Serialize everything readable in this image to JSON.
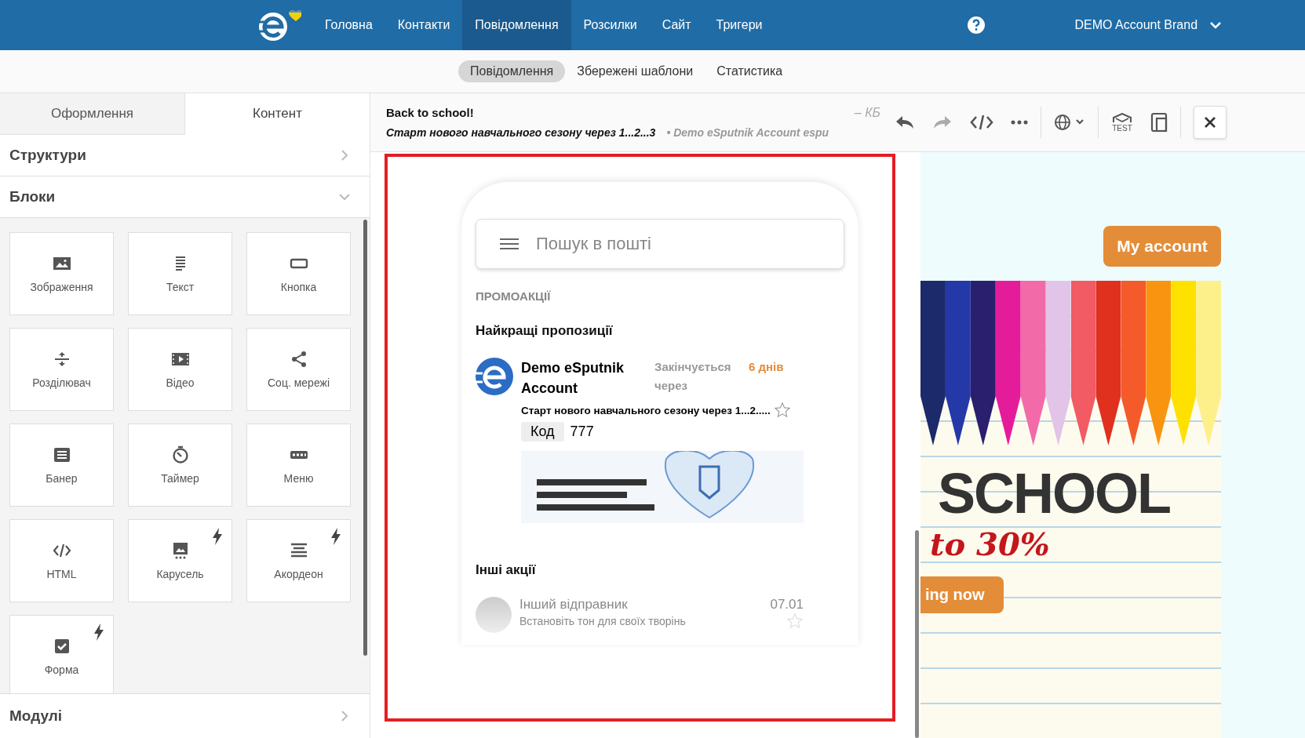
{
  "nav": {
    "items": [
      {
        "label": "Головна",
        "selected": false
      },
      {
        "label": "Контакти",
        "selected": false
      },
      {
        "label": "Повідомлення",
        "selected": true
      },
      {
        "label": "Розсилки",
        "selected": false
      },
      {
        "label": "Сайт",
        "selected": false
      },
      {
        "label": "Тригери",
        "selected": false
      }
    ],
    "account": "DEMO Account Brand"
  },
  "subnav": [
    {
      "label": "Повідомлення",
      "selected": true
    },
    {
      "label": "Збережені шаблони",
      "selected": false
    },
    {
      "label": "Статистика",
      "selected": false
    }
  ],
  "panel": {
    "tabs": [
      {
        "label": "Оформлення",
        "selected": false
      },
      {
        "label": "Контент",
        "selected": true
      }
    ],
    "sections": [
      {
        "title": "Структури",
        "expanded": false
      },
      {
        "title": "Блоки",
        "expanded": true
      }
    ],
    "blocks": [
      {
        "label": "Зображення",
        "kind": "image",
        "flash": false
      },
      {
        "label": "Текст",
        "kind": "text",
        "flash": false
      },
      {
        "label": "Кнопка",
        "kind": "button",
        "flash": false
      },
      {
        "label": "Розділювач",
        "kind": "divider",
        "flash": false
      },
      {
        "label": "Відео",
        "kind": "video",
        "flash": false
      },
      {
        "label": "Соц. мережі",
        "kind": "share",
        "flash": false
      },
      {
        "label": "Банер",
        "kind": "banner",
        "flash": false
      },
      {
        "label": "Таймер",
        "kind": "timer",
        "flash": false
      },
      {
        "label": "Меню",
        "kind": "menu",
        "flash": false
      },
      {
        "label": "HTML",
        "kind": "html",
        "flash": false
      },
      {
        "label": "Карусель",
        "kind": "carousel",
        "flash": true
      },
      {
        "label": "Акордеон",
        "kind": "accordion",
        "flash": true
      },
      {
        "label": "Форма",
        "kind": "form",
        "flash": true
      }
    ],
    "footer_section": {
      "title": "Модулі",
      "expanded": false
    }
  },
  "message": {
    "subject": "Back to school!",
    "preheader": "Старт нового навчального сезону через 1...2...3",
    "sender": "• Demo eSputnik Account espu",
    "size": "– КБ"
  },
  "toolbar": [
    {
      "kind": "undo",
      "disabled": false
    },
    {
      "kind": "redo",
      "disabled": true
    },
    {
      "kind": "code",
      "disabled": false
    },
    {
      "kind": "more",
      "disabled": false
    },
    {
      "kind": "language",
      "disabled": false
    },
    {
      "kind": "test",
      "disabled": false,
      "label": "TEST"
    },
    {
      "kind": "device",
      "disabled": false
    }
  ],
  "preview": {
    "search_placeholder": "Пошук в пошті",
    "category": "ПРОМОАКЦІЇ",
    "section_title": "Найкращі пропозиції",
    "promo": {
      "sender": "Demo eSputnik Account",
      "expires_label": "Закінчується через",
      "expires_value": "6 днів",
      "snippet": "Старт нового навчального сезону через 1...2.....",
      "starred": false,
      "code_label": "Код",
      "code": "777"
    },
    "other_title": "Інші акції",
    "other": {
      "sender": "Інший відправник",
      "date": "07.01",
      "snippet": "Встановіть тон для своїх творінь",
      "starred": false
    }
  },
  "email": {
    "account_button": "My account",
    "headline": "SCHOOL",
    "offer": "to 30%",
    "cta": "ing now"
  }
}
